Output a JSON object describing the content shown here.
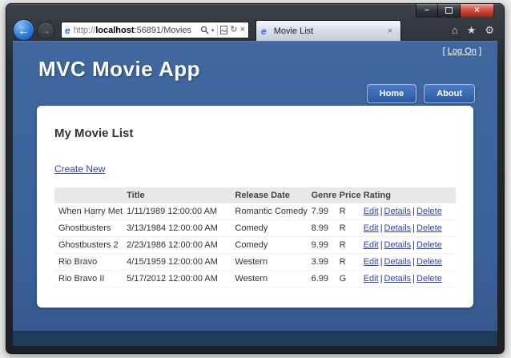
{
  "window": {
    "controls": {
      "minimize": "–",
      "close": "×"
    }
  },
  "browser": {
    "back_icon": "←",
    "forward_icon": "→",
    "address": {
      "scheme": "http://",
      "host": "localhost",
      "rest": ":56891/Movies"
    },
    "address_icons": {
      "caret": "▾",
      "refresh": "↻",
      "stop": "×"
    },
    "favicon_letter": "e",
    "tab": {
      "title": "Movie List",
      "close": "×"
    },
    "toolbar_icons": {
      "home": "⌂",
      "favorites": "★",
      "settings": "⚙"
    }
  },
  "app": {
    "logon": {
      "open": "[",
      "label": "Log On",
      "close": "]"
    },
    "title": "MVC Movie App",
    "nav": {
      "home": "Home",
      "about": "About"
    },
    "page": {
      "heading": "My Movie List",
      "create_link": "Create New",
      "table": {
        "headers": [
          "",
          "Title",
          "Release Date",
          "Genre",
          "Price",
          "Rating"
        ],
        "rows": [
          {
            "title": "When Harry Met Sally",
            "release_date": "1/11/1989 12:00:00 AM",
            "genre": "Romantic Comedy",
            "price": "7.99",
            "rating": "R"
          },
          {
            "title": "Ghostbusters",
            "release_date": "3/13/1984 12:00:00 AM",
            "genre": "Comedy",
            "price": "8.99",
            "rating": "R"
          },
          {
            "title": "Ghostbusters 2",
            "release_date": "2/23/1986 12:00:00 AM",
            "genre": "Comedy",
            "price": "9.99",
            "rating": "R"
          },
          {
            "title": "Rio Bravo",
            "release_date": "4/15/1959 12:00:00 AM",
            "genre": "Western",
            "price": "3.99",
            "rating": "R"
          },
          {
            "title": "Rio Bravo II",
            "release_date": "5/17/2012 12:00:00 AM",
            "genre": "Western",
            "price": "6.99",
            "rating": "G"
          }
        ],
        "actions": {
          "edit": "Edit",
          "details": "Details",
          "delete": "Delete",
          "separator": "|"
        }
      }
    }
  },
  "colors": {
    "app_background": "#3a6098",
    "footer_band": "#1e3a59",
    "nav_button": "#2c5aa0",
    "link": "#2c42b8",
    "table_header_bg": "#e8e8e8",
    "close_button_red": "#a12b1d"
  }
}
